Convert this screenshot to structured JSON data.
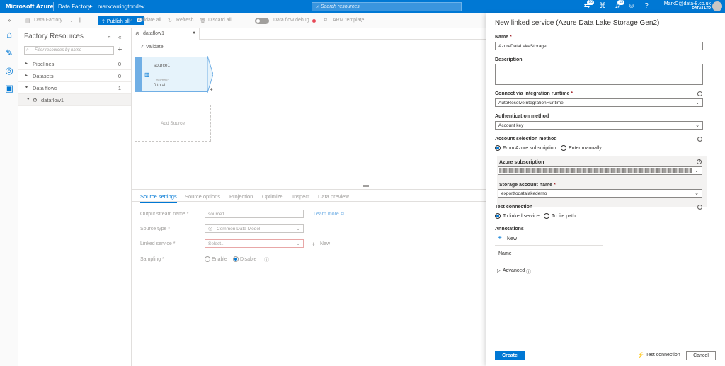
{
  "topbar": {
    "brand": "Microsoft Azure",
    "crumb1": "Data Factory",
    "crumb_sep": "▸",
    "crumb2": "markcarringtondev",
    "search_placeholder": "Search resources",
    "notif_count_1": "10",
    "notif_count_2": "15",
    "user_email": "MarkC@data-8.co.uk",
    "user_org": "DATA8 LTD"
  },
  "toolbar": {
    "data_factory": "Data Factory",
    "publish_all": "Publish all",
    "publish_count": "1",
    "validate_all": "Validate all",
    "refresh": "Refresh",
    "discard_all": "Discard all",
    "data_flow_debug": "Data flow debug",
    "arm_template": "ARM template"
  },
  "resources": {
    "title": "Factory Resources",
    "filter_placeholder": "Filter resources by name",
    "items": [
      {
        "label": "Pipelines",
        "count": "0"
      },
      {
        "label": "Datasets",
        "count": "0"
      },
      {
        "label": "Data flows",
        "count": "1"
      }
    ],
    "child": "dataflow1"
  },
  "canvas": {
    "tab": "dataflow1",
    "validate": "Validate",
    "node_title": "source1",
    "node_sub1": "Columns:",
    "node_sub2": "0 total",
    "add_source": "Add Source"
  },
  "bottom": {
    "tabs": [
      "Source settings",
      "Source options",
      "Projection",
      "Optimize",
      "Inspect",
      "Data preview"
    ],
    "output_label": "Output stream name",
    "output_value": "source1",
    "learn_more": "Learn more",
    "source_type_label": "Source type",
    "source_type_value": "Common Data Model",
    "linked_service_label": "Linked service",
    "linked_service_placeholder": "Select...",
    "new": "New",
    "sampling_label": "Sampling",
    "enable": "Enable",
    "disable": "Disable"
  },
  "panel": {
    "title": "New linked service (Azure Data Lake Storage Gen2)",
    "name_label": "Name",
    "name_value": "AzureDataLakeStorage",
    "description_label": "Description",
    "runtime_label": "Connect via integration runtime",
    "runtime_value": "AutoResolveIntegrationRuntime",
    "auth_label": "Authentication method",
    "auth_value": "Account key",
    "account_sel_label": "Account selection method",
    "from_sub": "From Azure subscription",
    "enter_manually": "Enter manually",
    "subscription_label": "Azure subscription",
    "storage_label": "Storage account name",
    "storage_value": "exporttodatalakedemo",
    "test_label": "Test connection",
    "to_linked": "To linked service",
    "to_file": "To file path",
    "annotations_label": "Annotations",
    "new": "New",
    "name_col": "Name",
    "advanced": "Advanced",
    "create": "Create",
    "test_connection": "Test connection",
    "cancel": "Cancel"
  }
}
